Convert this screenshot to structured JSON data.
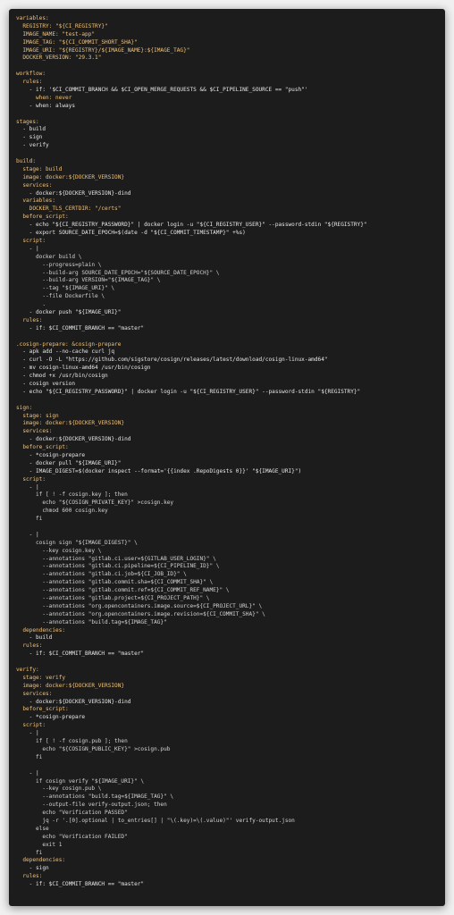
{
  "lines": [
    {
      "kind": "key",
      "text": "variables:"
    },
    {
      "kind": "key",
      "text": "  REGISTRY: \"${CI_REGISTRY}\""
    },
    {
      "kind": "key",
      "text": "  IMAGE_NAME: \"test-app\""
    },
    {
      "kind": "key",
      "text": "  IMAGE_TAG: \"${CI_COMMIT_SHORT_SHA}\""
    },
    {
      "kind": "key",
      "text": "  IMAGE_URI: \"${REGISTRY}/${IMAGE_NAME}:${IMAGE_TAG}\""
    },
    {
      "kind": "key",
      "text": "  DOCKER_VERSION: \"29.3.1\""
    },
    {
      "kind": "blank",
      "text": ""
    },
    {
      "kind": "key",
      "text": "workflow:"
    },
    {
      "kind": "key",
      "text": "  rules:"
    },
    {
      "kind": "dash",
      "text": "    - if: '$CI_COMMIT_BRANCH && $CI_OPEN_MERGE_REQUESTS && $CI_PIPELINE_SOURCE == \"push\"'"
    },
    {
      "kind": "key",
      "text": "      when: never"
    },
    {
      "kind": "dash",
      "text": "    - when: always"
    },
    {
      "kind": "blank",
      "text": ""
    },
    {
      "kind": "key",
      "text": "stages:"
    },
    {
      "kind": "dash",
      "text": "  - build"
    },
    {
      "kind": "dash",
      "text": "  - sign"
    },
    {
      "kind": "dash",
      "text": "  - verify"
    },
    {
      "kind": "blank",
      "text": ""
    },
    {
      "kind": "key",
      "text": "build:"
    },
    {
      "kind": "key",
      "text": "  stage: build"
    },
    {
      "kind": "key",
      "text": "  image: docker:${DOCKER_VERSION}"
    },
    {
      "kind": "key",
      "text": "  services:"
    },
    {
      "kind": "dash",
      "text": "    - docker:${DOCKER_VERSION}-dind"
    },
    {
      "kind": "key",
      "text": "  variables:"
    },
    {
      "kind": "key",
      "text": "    DOCKER_TLS_CERTDIR: \"/certs\""
    },
    {
      "kind": "key",
      "text": "  before_script:"
    },
    {
      "kind": "dash",
      "text": "    - echo \"${CI_REGISTRY_PASSWORD}\" | docker login -u \"${CI_REGISTRY_USER}\" --password-stdin \"${REGISTRY}\""
    },
    {
      "kind": "dash",
      "text": "    - export SOURCE_DATE_EPOCH=$(date -d \"${CI_COMMIT_TIMESTAMP}\" +%s)"
    },
    {
      "kind": "key",
      "text": "  script:"
    },
    {
      "kind": "dash",
      "text": "    - |"
    },
    {
      "kind": "code",
      "text": "      docker build \\"
    },
    {
      "kind": "code",
      "text": "        --progress=plain \\"
    },
    {
      "kind": "code",
      "text": "        --build-arg SOURCE_DATE_EPOCH=\"${SOURCE_DATE_EPOCH}\" \\"
    },
    {
      "kind": "code",
      "text": "        --build-arg VERSION=\"${IMAGE_TAG}\" \\"
    },
    {
      "kind": "code",
      "text": "        --tag \"${IMAGE_URI}\" \\"
    },
    {
      "kind": "code",
      "text": "        --file Dockerfile \\"
    },
    {
      "kind": "code",
      "text": "        ."
    },
    {
      "kind": "dash",
      "text": "    - docker push \"${IMAGE_URI}\""
    },
    {
      "kind": "key",
      "text": "  rules:"
    },
    {
      "kind": "dash",
      "text": "    - if: $CI_COMMIT_BRANCH == \"master\""
    },
    {
      "kind": "blank",
      "text": ""
    },
    {
      "kind": "key",
      "text": ".cosign-prepare: &cosign-prepare"
    },
    {
      "kind": "dash",
      "text": "  - apk add --no-cache curl jq"
    },
    {
      "kind": "dash",
      "text": "  - curl -O -L \"https://github.com/sigstore/cosign/releases/latest/download/cosign-linux-amd64\""
    },
    {
      "kind": "dash",
      "text": "  - mv cosign-linux-amd64 /usr/bin/cosign"
    },
    {
      "kind": "dash",
      "text": "  - chmod +x /usr/bin/cosign"
    },
    {
      "kind": "dash",
      "text": "  - cosign version"
    },
    {
      "kind": "dash",
      "text": "  - echo \"${CI_REGISTRY_PASSWORD}\" | docker login -u \"${CI_REGISTRY_USER}\" --password-stdin \"${REGISTRY}\""
    },
    {
      "kind": "blank",
      "text": ""
    },
    {
      "kind": "key",
      "text": "sign:"
    },
    {
      "kind": "key",
      "text": "  stage: sign"
    },
    {
      "kind": "key",
      "text": "  image: docker:${DOCKER_VERSION}"
    },
    {
      "kind": "key",
      "text": "  services:"
    },
    {
      "kind": "dash",
      "text": "    - docker:${DOCKER_VERSION}-dind"
    },
    {
      "kind": "key",
      "text": "  before_script:"
    },
    {
      "kind": "dash",
      "text": "    - *cosign-prepare"
    },
    {
      "kind": "dash",
      "text": "    - docker pull \"${IMAGE_URI}\""
    },
    {
      "kind": "dash",
      "text": "    - IMAGE_DIGEST=$(docker inspect --format='{{index .RepoDigests 0}}' \"${IMAGE_URI}\")"
    },
    {
      "kind": "key",
      "text": "  script:"
    },
    {
      "kind": "dash",
      "text": "    - |"
    },
    {
      "kind": "code",
      "text": "      if [ ! -f cosign.key ]; then"
    },
    {
      "kind": "code",
      "text": "        echo \"${COSIGN_PRIVATE_KEY}\" >cosign.key"
    },
    {
      "kind": "code",
      "text": "        chmod 600 cosign.key"
    },
    {
      "kind": "code",
      "text": "      fi"
    },
    {
      "kind": "blank",
      "text": ""
    },
    {
      "kind": "dash",
      "text": "    - |"
    },
    {
      "kind": "code",
      "text": "      cosign sign \"${IMAGE_DIGEST}\" \\"
    },
    {
      "kind": "code",
      "text": "        --key cosign.key \\"
    },
    {
      "kind": "code",
      "text": "        --annotations \"gitlab.ci.user=${GITLAB_USER_LOGIN}\" \\"
    },
    {
      "kind": "code",
      "text": "        --annotations \"gitlab.ci.pipeline=${CI_PIPELINE_ID}\" \\"
    },
    {
      "kind": "code",
      "text": "        --annotations \"gitlab.ci.job=${CI_JOB_ID}\" \\"
    },
    {
      "kind": "code",
      "text": "        --annotations \"gitlab.commit.sha=${CI_COMMIT_SHA}\" \\"
    },
    {
      "kind": "code",
      "text": "        --annotations \"gitlab.commit.ref=${CI_COMMIT_REF_NAME}\" \\"
    },
    {
      "kind": "code",
      "text": "        --annotations \"gitlab.project=${CI_PROJECT_PATH}\" \\"
    },
    {
      "kind": "code",
      "text": "        --annotations \"org.opencontainers.image.source=${CI_PROJECT_URL}\" \\"
    },
    {
      "kind": "code",
      "text": "        --annotations \"org.opencontainers.image.revision=${CI_COMMIT_SHA}\" \\"
    },
    {
      "kind": "code",
      "text": "        --annotations \"build.tag=${IMAGE_TAG}\""
    },
    {
      "kind": "key",
      "text": "  dependencies:"
    },
    {
      "kind": "dash",
      "text": "    - build"
    },
    {
      "kind": "key",
      "text": "  rules:"
    },
    {
      "kind": "dash",
      "text": "    - if: $CI_COMMIT_BRANCH == \"master\""
    },
    {
      "kind": "blank",
      "text": ""
    },
    {
      "kind": "key",
      "text": "verify:"
    },
    {
      "kind": "key",
      "text": "  stage: verify"
    },
    {
      "kind": "key",
      "text": "  image: docker:${DOCKER_VERSION}"
    },
    {
      "kind": "key",
      "text": "  services:"
    },
    {
      "kind": "dash",
      "text": "    - docker:${DOCKER_VERSION}-dind"
    },
    {
      "kind": "key",
      "text": "  before_script:"
    },
    {
      "kind": "dash",
      "text": "    - *cosign-prepare"
    },
    {
      "kind": "key",
      "text": "  script:"
    },
    {
      "kind": "dash",
      "text": "    - |"
    },
    {
      "kind": "code",
      "text": "      if [ ! -f cosign.pub ]; then"
    },
    {
      "kind": "code",
      "text": "        echo \"${COSIGN_PUBLIC_KEY}\" >cosign.pub"
    },
    {
      "kind": "code",
      "text": "      fi"
    },
    {
      "kind": "blank",
      "text": ""
    },
    {
      "kind": "dash",
      "text": "    - |"
    },
    {
      "kind": "code",
      "text": "      if cosign verify \"${IMAGE_URI}\" \\"
    },
    {
      "kind": "code",
      "text": "        --key cosign.pub \\"
    },
    {
      "kind": "code",
      "text": "        --annotations \"build.tag=${IMAGE_TAG}\" \\"
    },
    {
      "kind": "code",
      "text": "        --output-file verify-output.json; then"
    },
    {
      "kind": "code",
      "text": "        echo \"Verification PASSED\""
    },
    {
      "kind": "code",
      "text": "        jq -r '.[0].optional | to_entries[] | \"\\(.key)=\\(.value)\"' verify-output.json"
    },
    {
      "kind": "code",
      "text": "      else"
    },
    {
      "kind": "code",
      "text": "        echo \"Verification FAILED\""
    },
    {
      "kind": "code",
      "text": "        exit 1"
    },
    {
      "kind": "code",
      "text": "      fi"
    },
    {
      "kind": "key",
      "text": "  dependencies:"
    },
    {
      "kind": "dash",
      "text": "    - sign"
    },
    {
      "kind": "key",
      "text": "  rules:"
    },
    {
      "kind": "dash",
      "text": "    - if: $CI_COMMIT_BRANCH == \"master\""
    }
  ]
}
